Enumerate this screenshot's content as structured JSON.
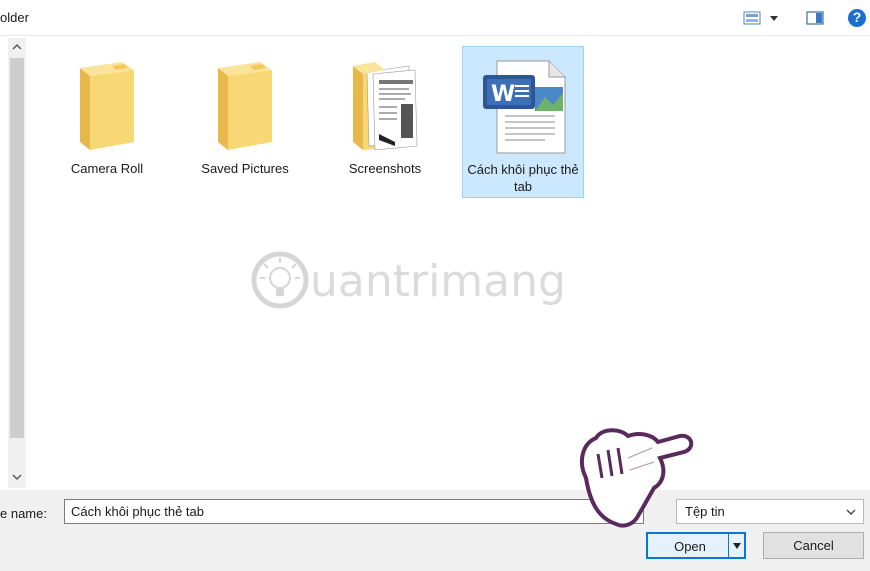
{
  "toolbar": {
    "title_fragment": "older",
    "view_icon": "view-options-icon",
    "pane_icon": "preview-pane-icon",
    "help_icon": "help-icon",
    "help_glyph": "?"
  },
  "scrollbar": {
    "up": "^",
    "down": "v"
  },
  "files": [
    {
      "name": "Camera Roll",
      "icon": "folder-icon"
    },
    {
      "name": "Saved Pictures",
      "icon": "folder-icon"
    },
    {
      "name": "Screenshots",
      "icon": "folder-with-documents-icon"
    },
    {
      "name": "Cách khôi phục thẻ tab",
      "icon": "word-document-icon",
      "selected": true
    }
  ],
  "watermark": {
    "text": "uantrimang"
  },
  "footer": {
    "filename_label": "e name:",
    "filename_value": "Cách khôi phục thẻ tab",
    "filter_value": "Tệp tin",
    "open_label": "Open",
    "cancel_label": "Cancel"
  },
  "colors": {
    "selection": "#cce8ff",
    "selection_border": "#99d1ff",
    "folder": "#f8d775",
    "accent": "#0078d7"
  }
}
